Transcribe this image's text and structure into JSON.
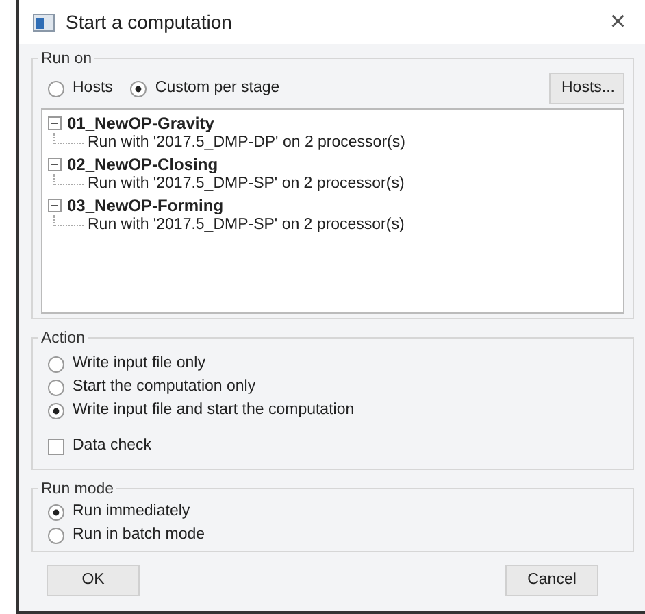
{
  "window": {
    "title": "Start a computation",
    "close": "×"
  },
  "run_on": {
    "label": "Run on",
    "options": [
      {
        "label": "Hosts",
        "selected": false
      },
      {
        "label": "Custom per stage",
        "selected": true
      }
    ],
    "hosts_button": "Hosts...",
    "stages": [
      {
        "name": "01_NewOP-Gravity",
        "expanded": true,
        "children": [
          {
            "name": "Run with '2017.5_DMP-DP' on 2 processor(s)"
          }
        ]
      },
      {
        "name": "02_NewOP-Closing",
        "expanded": true,
        "children": [
          {
            "name": "Run with '2017.5_DMP-SP' on 2 processor(s)"
          }
        ]
      },
      {
        "name": "03_NewOP-Forming",
        "expanded": true,
        "children": [
          {
            "name": "Run with '2017.5_DMP-SP' on 2 processor(s)"
          }
        ]
      }
    ]
  },
  "action": {
    "label": "Action",
    "options": [
      {
        "label": "Write input file only",
        "selected": false
      },
      {
        "label": "Start the computation only",
        "selected": false
      },
      {
        "label": "Write input file and start the computation",
        "selected": true
      }
    ],
    "data_check": {
      "label": "Data check",
      "checked": false
    }
  },
  "run_mode": {
    "label": "Run mode",
    "options": [
      {
        "label": "Run immediately",
        "selected": true
      },
      {
        "label": "Run in batch mode",
        "selected": false
      }
    ]
  },
  "buttons": [
    "OK",
    "Cancel"
  ]
}
